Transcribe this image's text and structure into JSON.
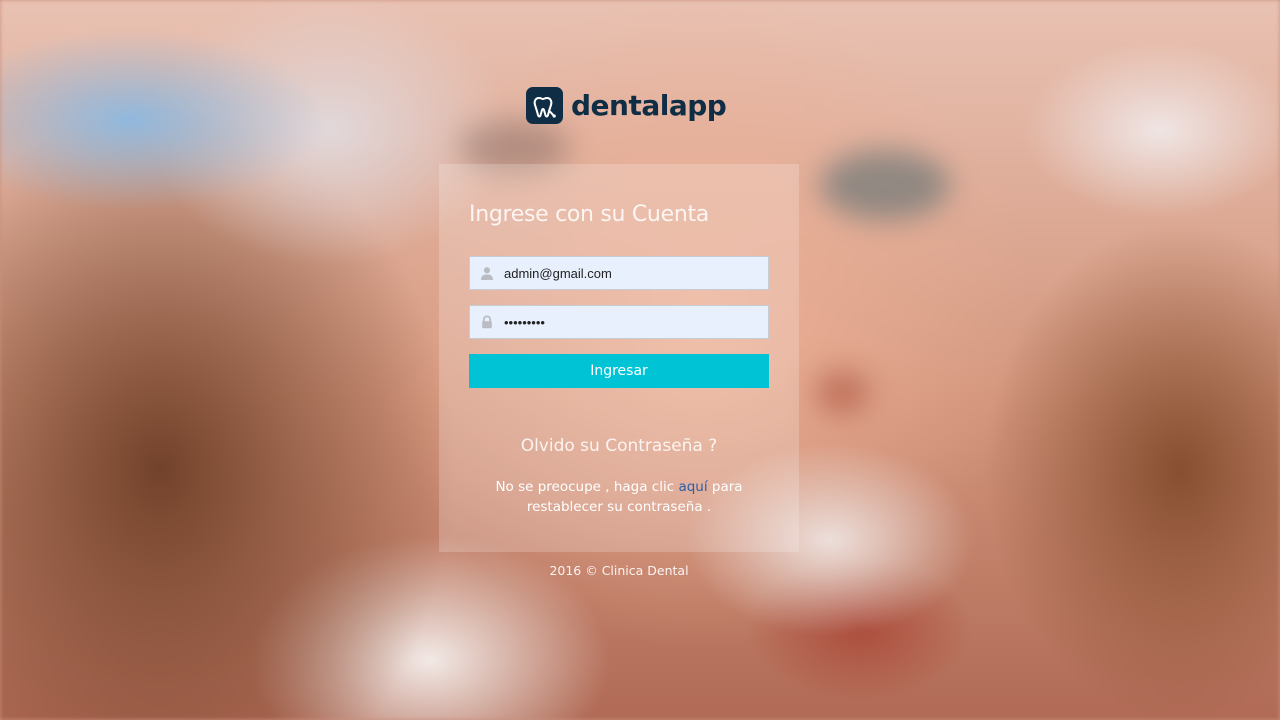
{
  "brand": {
    "name": "dentalapp",
    "icon": "tooth-icon",
    "color": "#0f2e45"
  },
  "login": {
    "title": "Ingrese con su Cuenta",
    "email_value": "admin@gmail.com",
    "email_icon": "user-icon",
    "password_value": "•••••••••",
    "password_icon": "lock-icon",
    "submit_label": "Ingresar",
    "submit_color": "#00c4d6"
  },
  "forgot": {
    "title": "Olvido su Contraseña ?",
    "text_before": "No se preocupe , haga clic ",
    "link_label": "aquí",
    "text_after": " para restablecer su contraseña .",
    "link_color": "#2f5da8"
  },
  "footer": {
    "text": "2016 © Clinica Dental"
  }
}
